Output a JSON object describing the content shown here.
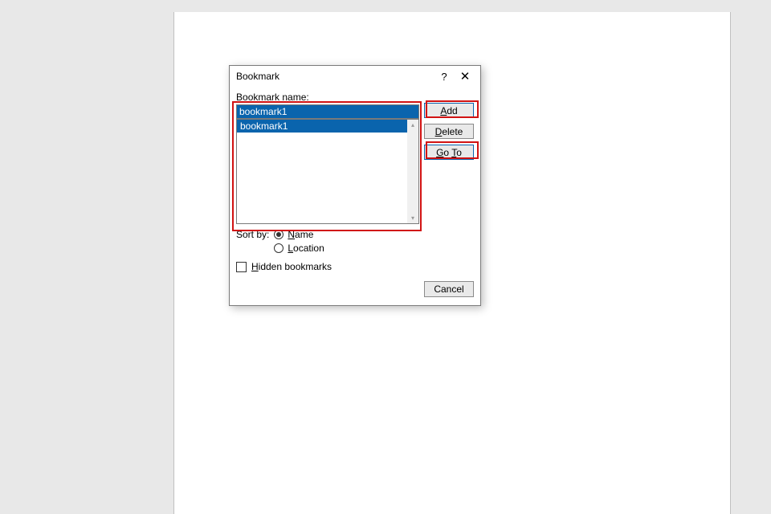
{
  "dialog": {
    "title": "Bookmark",
    "help_symbol": "?",
    "close_symbol": "✕",
    "name_label_pre": "B",
    "name_label_post": "ookmark name:",
    "name_value": "bookmark1",
    "list_items": [
      "bookmark1"
    ],
    "sort_label": "Sort by:",
    "sort_options": {
      "name_pre": "N",
      "name_post": "ame",
      "location_pre": "L",
      "location_post": "ocation",
      "selected": "name"
    },
    "hidden_label_pre": "H",
    "hidden_label_post": "idden bookmarks",
    "hidden_checked": false,
    "buttons": {
      "add_pre": "A",
      "add_post": "dd",
      "delete_pre": "D",
      "delete_post": "elete",
      "goto_pre": "G",
      "goto_mid": "o ",
      "goto_under": "T",
      "goto_post": "o",
      "cancel": "Cancel"
    }
  }
}
